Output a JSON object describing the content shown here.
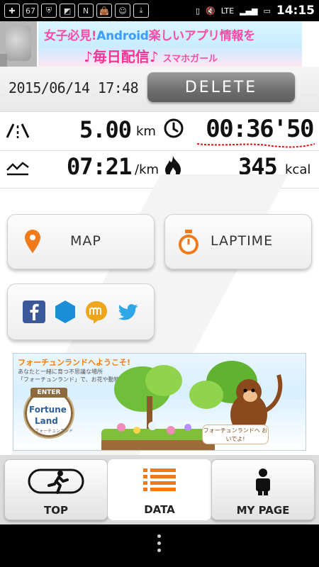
{
  "status_bar": {
    "notification_count": "67",
    "network": "LTE",
    "time": "14:15"
  },
  "ad_banner": {
    "text_prefix": "女子必見!",
    "text_android": "Android",
    "text_rest": "楽しいアプリ情報を",
    "text_line2": "♪毎日配信♪",
    "text_brand": "スマホガール"
  },
  "header": {
    "datetime": "2015/06/14  17:48",
    "delete_label": "DELETE"
  },
  "stats": {
    "distance_value": "5.00",
    "distance_unit": "km",
    "duration_value": "00:36'50",
    "pace_value": "07:21",
    "pace_unit": "/km",
    "calories_value": "345",
    "calories_unit": "kcal"
  },
  "actions": {
    "map_label": "MAP",
    "laptime_label": "LAPTIME"
  },
  "share_icons": [
    "facebook-icon",
    "hexagon-icon",
    "mixi-icon",
    "twitter-icon"
  ],
  "fortune_banner": {
    "title": "フォーチュンランドへようこそ!",
    "desc_line1": "あなたと一緒に育つ不思議な場所",
    "desc_line2": "「フォーチュンランド」で、お花や動物がまっているよ",
    "enter": "ENTER",
    "name_line1": "Fortune",
    "name_line2": "Land",
    "name_sub": "フォーチュンランド",
    "speech": "フォーチュンランドへ おいでよ!"
  },
  "nav": {
    "top_label": "TOP",
    "data_label": "DATA",
    "mypage_label": "MY PAGE"
  },
  "colors": {
    "accent_orange": "#f07a1a",
    "delete_gray": "#6e6e6e",
    "annotation_red": "#e01010"
  }
}
